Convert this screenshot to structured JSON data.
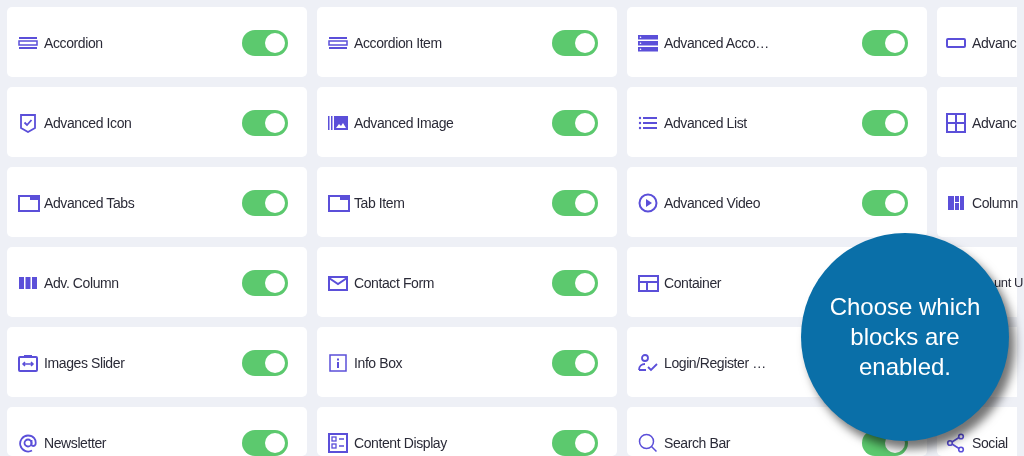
{
  "blocks": [
    {
      "label": "Accordion",
      "on": true
    },
    {
      "label": "Accordion Item",
      "on": true
    },
    {
      "label": "Advanced Acco…",
      "on": true
    },
    {
      "label": "Advanc"
    },
    {
      "label": "Advanced Icon",
      "on": true
    },
    {
      "label": "Advanced Image",
      "on": true
    },
    {
      "label": "Advanced List",
      "on": true
    },
    {
      "label": "Advanc"
    },
    {
      "label": "Advanced Tabs",
      "on": true
    },
    {
      "label": "Tab Item",
      "on": true
    },
    {
      "label": "Advanced Video",
      "on": true
    },
    {
      "label": "Column"
    },
    {
      "label": "Adv. Column",
      "on": true
    },
    {
      "label": "Contact Form",
      "on": true
    },
    {
      "label": "Container"
    },
    {
      "label": "unt U",
      "kind": "partial"
    },
    {
      "label": "Images Slider",
      "on": true
    },
    {
      "label": "Info Box",
      "on": true
    },
    {
      "label": "Login/Register …"
    },
    {
      "kind": "empty"
    },
    {
      "label": "Newsletter",
      "on": true
    },
    {
      "label": "Content Display",
      "on": true
    },
    {
      "label": "Search Bar",
      "on": true
    },
    {
      "label": "Social"
    }
  ],
  "callout": {
    "text": "Choose which blocks are enabled."
  }
}
